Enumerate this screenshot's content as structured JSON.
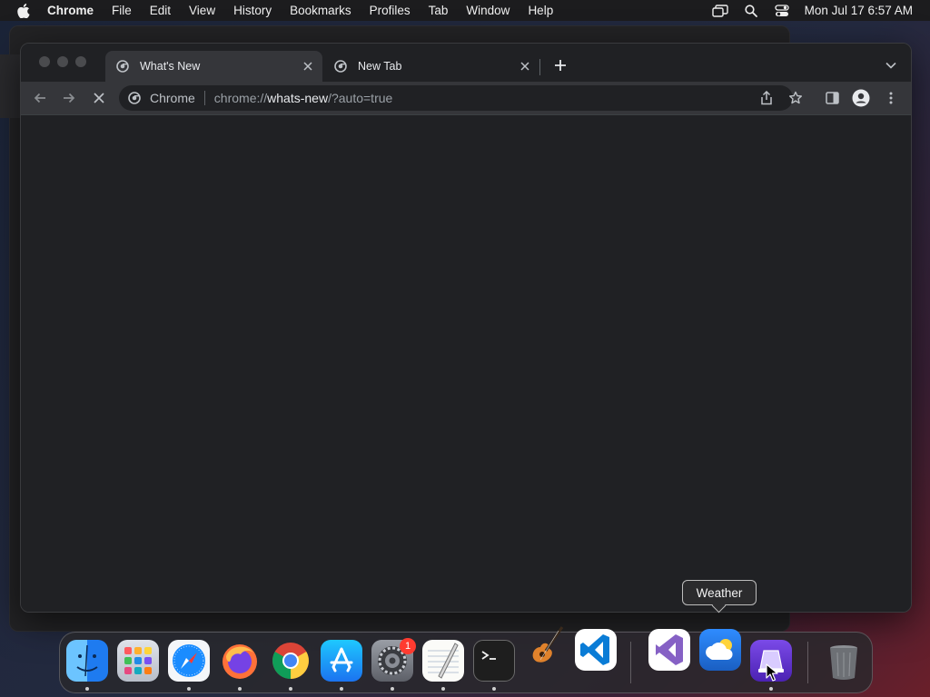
{
  "menubar": {
    "app_name": "Chrome",
    "items": [
      "File",
      "Edit",
      "View",
      "History",
      "Bookmarks",
      "Profiles",
      "Tab",
      "Window",
      "Help"
    ],
    "clock": "Mon Jul 17  6:57 AM"
  },
  "browser": {
    "tabs": [
      {
        "title": "What's New",
        "active": true
      },
      {
        "title": "New Tab",
        "active": false
      }
    ],
    "omnibox": {
      "chip_label": "Chrome",
      "url_scheme": "chrome://",
      "url_host": "whats-new",
      "url_rest": "/?auto=true"
    }
  },
  "tooltip": {
    "text": "Weather"
  },
  "dock": {
    "apps": [
      "Finder",
      "Launchpad",
      "Safari",
      "Firefox",
      "Google Chrome",
      "App Store",
      "System Settings",
      "TextEdit",
      "Terminal",
      "GarageBand",
      "Visual Studio Code",
      "Visual Studio",
      "Weather",
      "Simulator",
      "Trash"
    ],
    "settings_badge": "1"
  },
  "colors": {
    "chrome_tab_active": "#35363a",
    "chrome_bg": "#202124",
    "badge": "#ff3b30",
    "accent_blue": "#1a73e8"
  }
}
